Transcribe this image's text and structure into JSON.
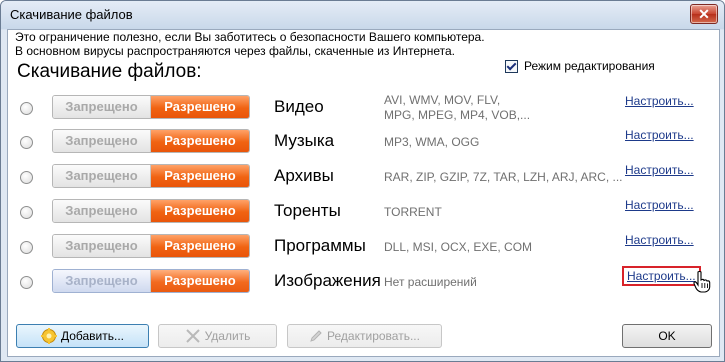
{
  "window": {
    "title": "Скачивание файлов",
    "close_label": "✕"
  },
  "info": {
    "line1": "Это ограничение полезно, если Вы заботитесь  о безопасности Вашего компьютера.",
    "line2": "В основном вирусы распространяются через файлы, скаченные из Интернета."
  },
  "section_title": "Скачивание файлов:",
  "edit_mode_label": "Режим редактирования",
  "toggle": {
    "off_label": "Запрещено",
    "on_label": "Разрешено"
  },
  "configure_label": "Настроить...",
  "rows": [
    {
      "category": "Видео",
      "ext_line1": "AVI, WMV, MOV, FLV,",
      "ext_line2": "MPG, MPEG, MP4, VOB,..."
    },
    {
      "category": "Музыка",
      "ext_line1": "MP3, WMA, OGG",
      "ext_line2": ""
    },
    {
      "category": "Архивы",
      "ext_line1": "RAR, ZIP, GZIP, 7Z, TAR, LZH, ARJ, ARC, ...",
      "ext_line2": ""
    },
    {
      "category": "Торенты",
      "ext_line1": "TORRENT",
      "ext_line2": ""
    },
    {
      "category": "Программы",
      "ext_line1": "DLL, MSI, OCX, EXE, COM",
      "ext_line2": ""
    },
    {
      "category": "Изображения",
      "ext_line1": "Нет расширений",
      "ext_line2": ""
    }
  ],
  "buttons": {
    "add": "Добавить...",
    "delete": "Удалить",
    "edit": "Редактировать...",
    "ok": "OK"
  },
  "colors": {
    "accent_orange": "#f06312",
    "link_blue": "#1d3a8a",
    "focus_red": "#d8232a"
  }
}
